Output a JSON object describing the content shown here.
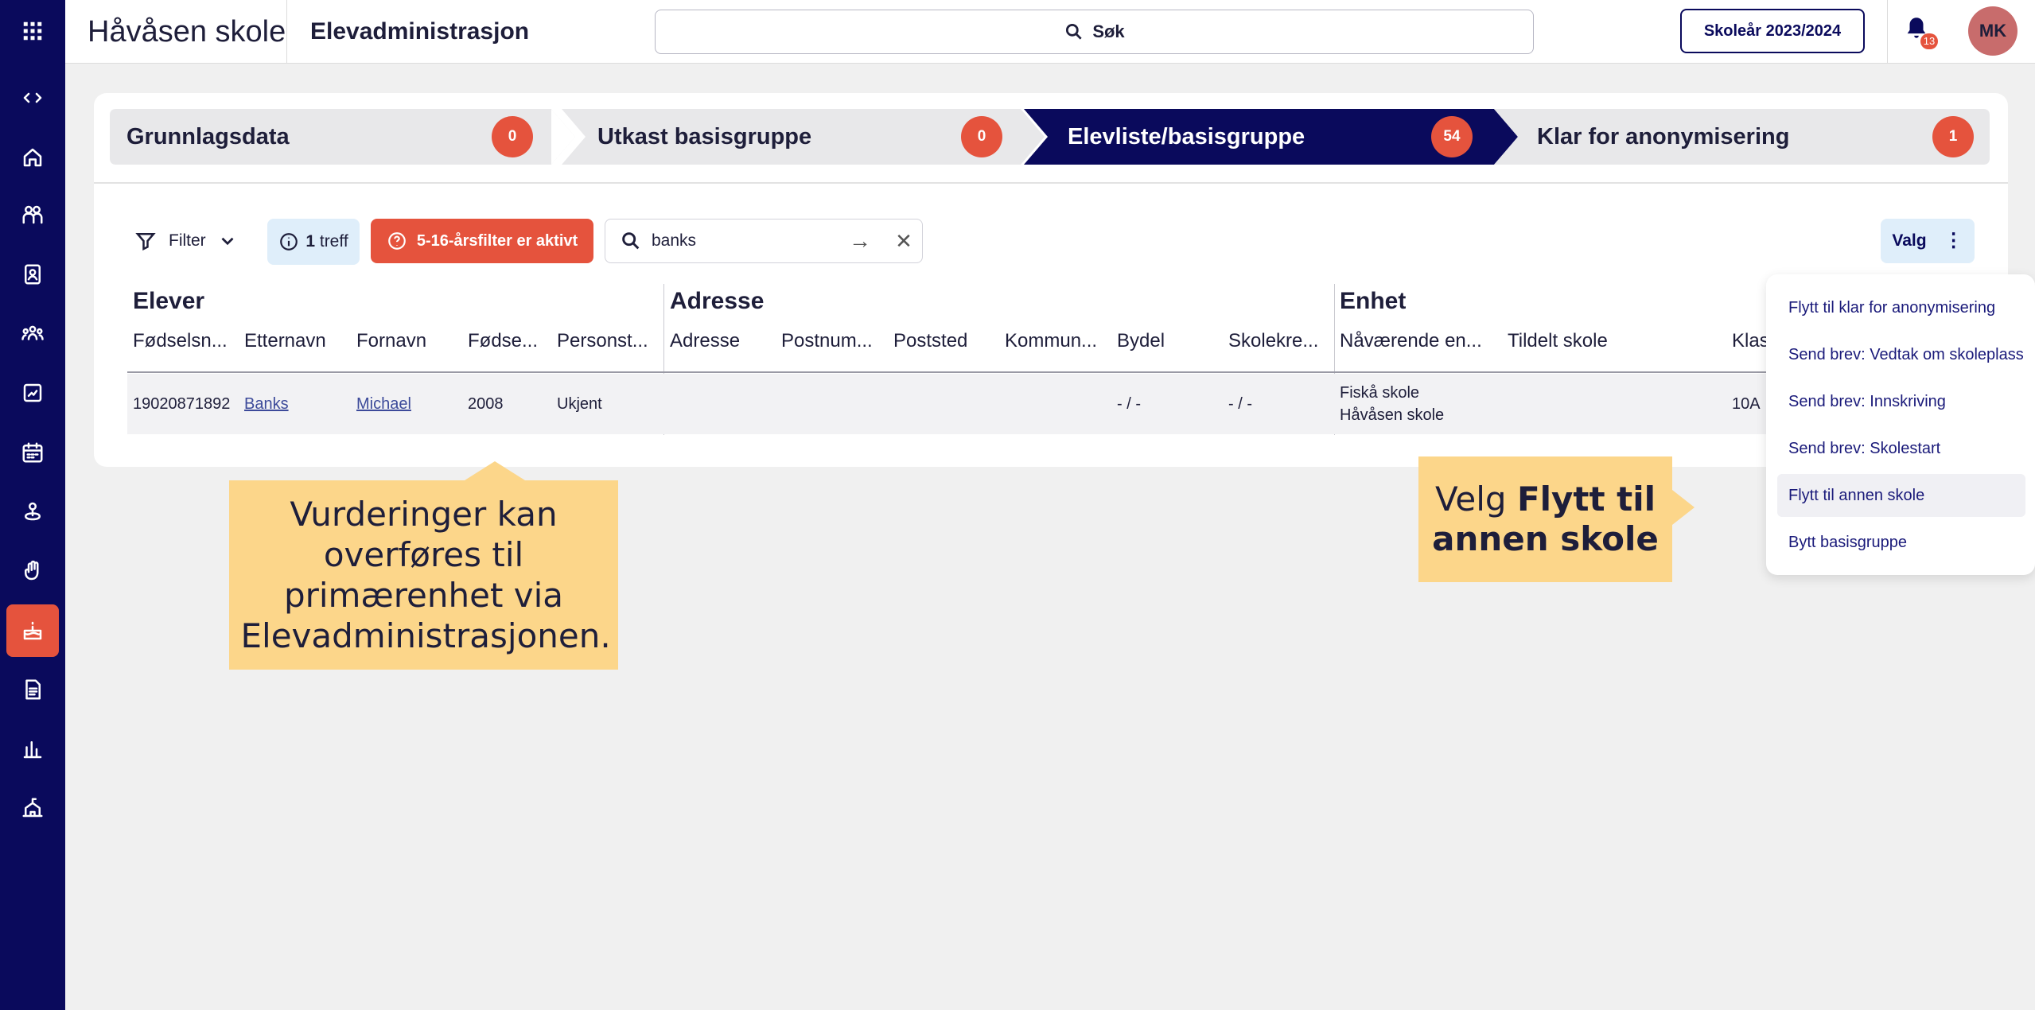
{
  "topbar": {
    "brand": "Håvåsen skole",
    "app_title": "Elevadministrasjon",
    "search_label": "Søk",
    "school_year": "Skoleår 2023/2024",
    "notification_count": "13",
    "avatar_initials": "MK"
  },
  "sidebar": {
    "items": [
      {
        "icon": "apps-grid-icon"
      },
      {
        "icon": "code-toggle-icon"
      },
      {
        "icon": "home-icon"
      },
      {
        "icon": "people-group-icon"
      },
      {
        "icon": "id-badge-icon"
      },
      {
        "icon": "team-icon"
      },
      {
        "icon": "report-icon"
      },
      {
        "icon": "calendar-icon"
      },
      {
        "icon": "person-pin-icon"
      },
      {
        "icon": "hand-icon"
      },
      {
        "icon": "cake-icon",
        "active": true
      },
      {
        "icon": "document-icon"
      },
      {
        "icon": "bar-chart-icon"
      },
      {
        "icon": "school-icon"
      }
    ]
  },
  "steps": [
    {
      "label": "Grunnlagsdata",
      "count": "0",
      "active": false
    },
    {
      "label": "Utkast basisgruppe",
      "count": "0",
      "active": false
    },
    {
      "label": "Elevliste/basisgruppe",
      "count": "54",
      "active": true
    },
    {
      "label": "Klar for anonymisering",
      "count": "1",
      "active": false
    }
  ],
  "toolbar": {
    "filter_label": "Filter",
    "hits_count": "1",
    "hits_label": "treff",
    "age_filter_label": "5-16-årsfilter er aktivt",
    "search_value": "banks",
    "valg_label": "Valg"
  },
  "table": {
    "groups": {
      "elever": "Elever",
      "adresse": "Adresse",
      "enhet": "Enhet"
    },
    "columns": [
      "Fødselsn...",
      "Etternavn",
      "Fornavn",
      "Fødse...",
      "Personst...",
      "Adresse",
      "Postnum...",
      "Poststed",
      "Kommun...",
      "Bydel",
      "Skolekre...",
      "Nåværende en...",
      "Tildelt skole",
      "Klas"
    ],
    "row": {
      "fodselsnummer": "19020871892",
      "etternavn": "Banks",
      "fornavn": "Michael",
      "fodselsar": "2008",
      "personstatus": "Ukjent",
      "bydel": "- / -",
      "skolekrets": "- / -",
      "naavaerende_enhet_1": "Fiskå skole",
      "naavaerende_enhet_2": "Håvåsen skole",
      "klasse": "10A"
    }
  },
  "menu": {
    "items": [
      "Flytt til klar for anonymisering",
      "Send brev: Vedtak om skoleplass",
      "Send brev: Innskriving",
      "Send brev: Skolestart",
      "Flytt til annen skole",
      "Bytt basisgruppe"
    ]
  },
  "callouts": {
    "left_text": "Vurderinger kan overføres til primærenhet via Elevadministrasjonen.",
    "right_prefix": "Velg",
    "right_bold": "Flytt til annen skole"
  },
  "colors": {
    "sidebar_bg": "#0a0a5c",
    "accent": "#e5533d",
    "callout": "#fcd68a",
    "active_step": "#0a0a5c"
  }
}
